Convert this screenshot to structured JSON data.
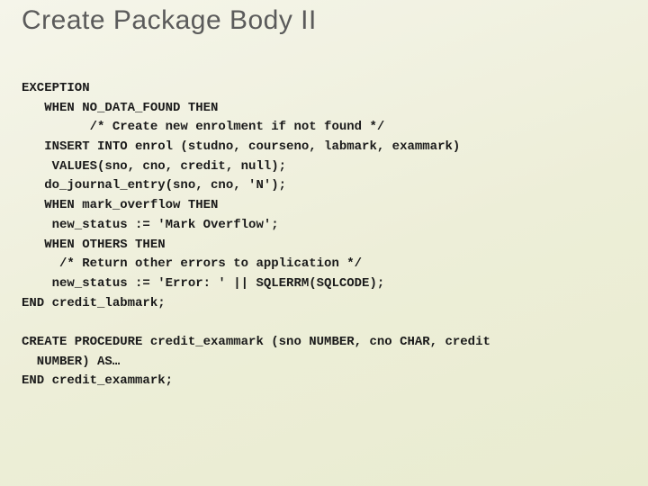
{
  "title": "Create Package Body II",
  "code": {
    "l01": "EXCEPTION",
    "l02": "   WHEN NO_DATA_FOUND THEN",
    "l03": "         /* Create new enrolment if not found */",
    "l04": "   INSERT INTO enrol (studno, courseno, labmark, exammark)",
    "l05": "    VALUES(sno, cno, credit, null);",
    "l06": "   do_journal_entry(sno, cno, 'N');",
    "l07": "   WHEN mark_overflow THEN",
    "l08": "    new_status := 'Mark Overflow';",
    "l09": "   WHEN OTHERS THEN",
    "l10": "     /* Return other errors to application */",
    "l11": "    new_status := 'Error: ' || SQLERRM(SQLCODE);",
    "l12": "END credit_labmark;",
    "l13": "",
    "l14": "CREATE PROCEDURE credit_exammark (sno NUMBER, cno CHAR, credit",
    "l15": "  NUMBER) AS…",
    "l16": "END credit_exammark;"
  }
}
